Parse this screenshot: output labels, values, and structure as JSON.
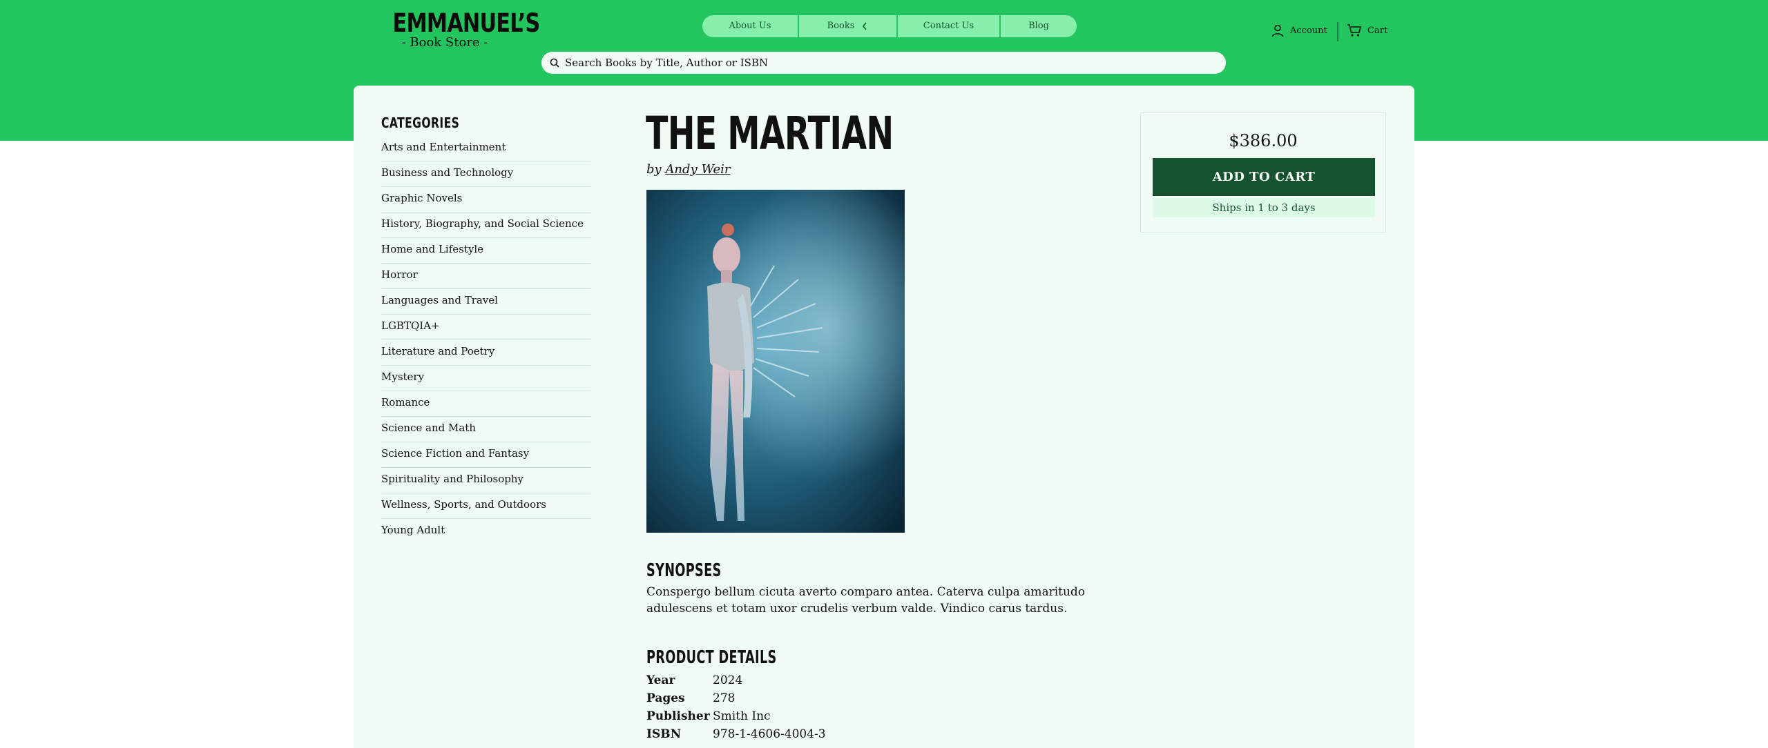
{
  "brand": {
    "name": "EMMANUEL’S",
    "tagline": "- Book Store -"
  },
  "nav": {
    "items": [
      {
        "label": "About Us"
      },
      {
        "label": "Books"
      },
      {
        "label": "Contact Us"
      },
      {
        "label": "Blog"
      }
    ]
  },
  "header": {
    "account_label": "Account",
    "cart_label": "Cart"
  },
  "search": {
    "placeholder": "Search Books by Title, Author or ISBN"
  },
  "sidebar": {
    "heading": "CATEGORIES",
    "categories": [
      "Arts and Entertainment",
      "Business and Technology",
      "Graphic Novels",
      "History, Biography, and Social Science",
      "Home and Lifestyle",
      "Horror",
      "Languages and Travel",
      "LGBTQIA+",
      "Literature and Poetry",
      "Mystery",
      "Romance",
      "Science and Math",
      "Science Fiction and Fantasy",
      "Spirituality and Philosophy",
      "Wellness, Sports, and Outdoors",
      "Young Adult"
    ]
  },
  "product": {
    "title": "THE MARTIAN",
    "by_prefix": "by",
    "author": "Andy Weir",
    "synopsis_heading": "SYNOPSES",
    "synopsis": "Conspergo bellum cicuta averto comparo antea. Caterva culpa amaritudo adulescens et totam uxor crudelis verbum valde. Vindico carus tardus.",
    "details_heading": "PRODUCT DETAILS",
    "details": [
      {
        "key": "Year",
        "value": "2024"
      },
      {
        "key": "Pages",
        "value": "278"
      },
      {
        "key": "Publisher",
        "value": "Smith Inc"
      },
      {
        "key": "ISBN",
        "value": "978-1-4606-4004-3"
      }
    ]
  },
  "purchase": {
    "price": "$386.00",
    "add_to_cart_label": "ADD TO CART",
    "shipping_note": "Ships in 1 to 3 days"
  },
  "colors": {
    "header_green": "#22c55e",
    "nav_pill": "#86efac",
    "card_bg": "#effbf3",
    "button_dark": "#14532d",
    "ship_bg": "#dcfce7"
  },
  "icons": [
    "search-icon",
    "user-icon",
    "cart-icon",
    "chevron-left-icon"
  ]
}
